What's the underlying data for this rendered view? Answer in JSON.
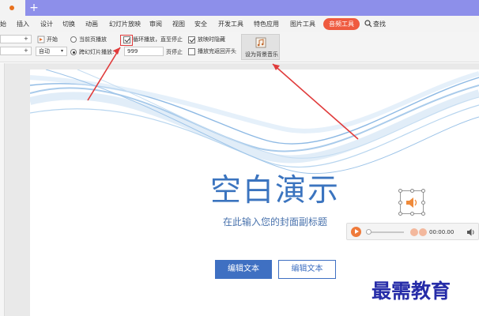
{
  "window": {
    "new_tab_symbol": "+"
  },
  "menu": {
    "items": [
      "始",
      "插入",
      "设计",
      "切换",
      "动画",
      "幻灯片放映",
      "审阅",
      "视图",
      "安全",
      "开发工具",
      "特色应用",
      "图片工具"
    ],
    "active_tab": "音频工具",
    "search_label": "查找"
  },
  "ribbon": {
    "start_label": "开始",
    "current_page_label": "当前页播放",
    "cross_slide_label": "跨幻灯片播放:",
    "loop_label": "循环播放，直至停止",
    "hide_label": "放映时隐藏",
    "rewind_label": "播放完返回开头",
    "auto_label": "自动",
    "page_value": "999",
    "page_stop_label": "页停止",
    "plus1": "+",
    "plus2": "+",
    "bg_music_label": "设为背景音乐",
    "loop_checked": true,
    "hide_checked": true,
    "rewind_checked": false,
    "mode_selected": "跨幻灯片播放"
  },
  "slide": {
    "title": "空白演示",
    "subtitle": "在此输入您的封面副标题",
    "button_primary": "编辑文本",
    "button_secondary": "编辑文本",
    "accent_color": "#3f70c2"
  },
  "player": {
    "time": "00:00.00"
  },
  "watermark": "最需教育",
  "icons": [
    "search-icon",
    "speaker-icon",
    "music-icon",
    "play-icon",
    "volume-icon"
  ]
}
